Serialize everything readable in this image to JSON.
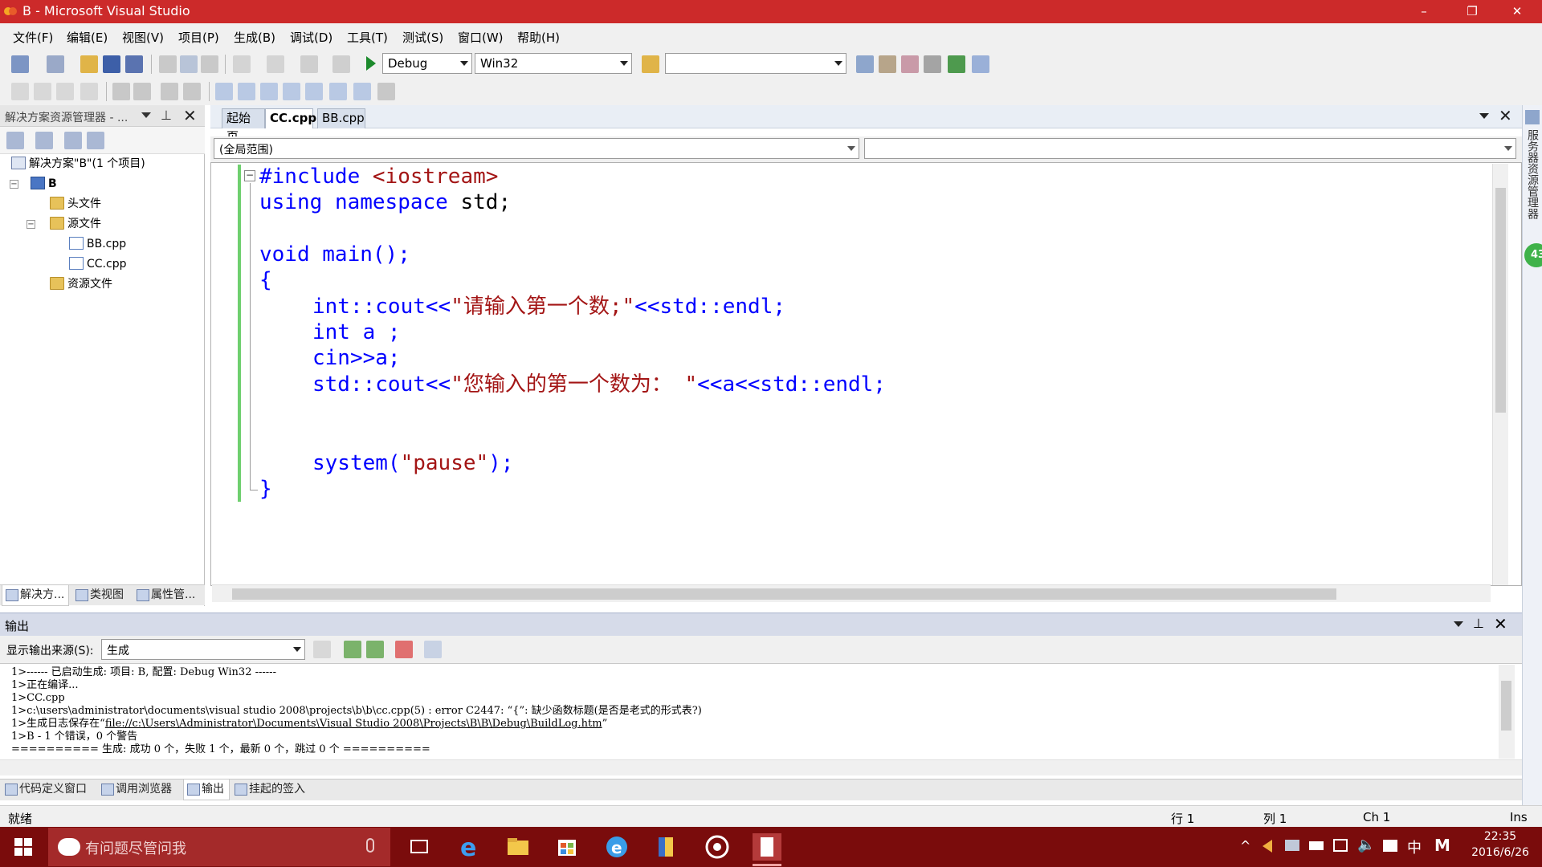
{
  "window": {
    "title": "B - Microsoft Visual Studio",
    "controls": {
      "minimize": "–",
      "restore": "❐",
      "close": "✕"
    }
  },
  "menu": [
    "文件(F)",
    "编辑(E)",
    "视图(V)",
    "项目(P)",
    "生成(B)",
    "调试(D)",
    "工具(T)",
    "测试(S)",
    "窗口(W)",
    "帮助(H)"
  ],
  "toolbar": {
    "config": "Debug",
    "platform": "Win32",
    "find": ""
  },
  "solution_explorer": {
    "title": "解决方案资源管理器 - ...",
    "tree": {
      "solution": "解决方案\"B\"(1 个项目)",
      "project": "B",
      "headers": "头文件",
      "sources": "源文件",
      "file1": "BB.cpp",
      "file2": "CC.cpp",
      "resources": "资源文件"
    },
    "tabs": [
      "解决方...",
      "类视图",
      "属性管..."
    ]
  },
  "editor": {
    "tabs": [
      "起始页",
      "CC.cpp",
      "BB.cpp"
    ],
    "scope": "(全局范围)",
    "member": "",
    "code": {
      "l1_pp": "#include",
      "l1_str": " <iostream>",
      "l2_kw1": "using",
      "l2_kw2": "namespace",
      "l2_rest": " std;",
      "l4_kw": "void",
      "l4_rest": " main();",
      "l5": "{",
      "l6_kw": "int",
      "l6_rest": "::cout<<",
      "l6_str": "\"请输入第一个数;\"",
      "l6_end": "<<std::endl;",
      "l7_kw": "int",
      "l7_rest": " a ;",
      "l8": "cin>>a;",
      "l9_a": "std::cout<<",
      "l9_str": "\"您输入的第一个数为： \"",
      "l9_end": "<<a<<std::endl;",
      "l12_a": "system(",
      "l12_str": "\"pause\"",
      "l12_end": ");",
      "l13": "}"
    }
  },
  "output": {
    "title": "输出",
    "source_label": "显示输出来源(S):",
    "source_value": "生成",
    "lines": [
      "1>------ 已启动生成: 项目: B, 配置: Debug Win32 ------",
      "1>正在编译...",
      "1>CC.cpp",
      "1>c:\\users\\administrator\\documents\\visual studio 2008\\projects\\b\\b\\cc.cpp(5) : error C2447: “{”: 缺少函数标题(是否是老式的形式表?)",
      "1>生成日志保存在“",
      "file://c:\\Users\\Administrator\\Documents\\Visual Studio 2008\\Projects\\B\\B\\Debug\\BuildLog.htm",
      "”",
      "1>B - 1 个错误，0 个警告",
      "========== 生成: 成功 0 个，失败 1 个，最新 0 个，跳过 0 个 =========="
    ],
    "tabs": [
      "代码定义窗口",
      "调用浏览器",
      "输出",
      "挂起的签入"
    ]
  },
  "statusbar": {
    "ready": "就绪",
    "row": "行 1",
    "col": "列 1",
    "ch": "Ch 1",
    "mode": "Ins"
  },
  "right_strip": {
    "label": "服务器资源管理器",
    "badge": "43"
  },
  "taskbar": {
    "search": "有问题尽管问我",
    "time": "22:35",
    "date": "2016/6/26",
    "ime": "中",
    "ime2": "M"
  },
  "colors": {
    "titlebar": "#cc2a2a",
    "taskbar": "#7a0c0c",
    "keyword": "#0000ff",
    "string": "#a31515"
  }
}
